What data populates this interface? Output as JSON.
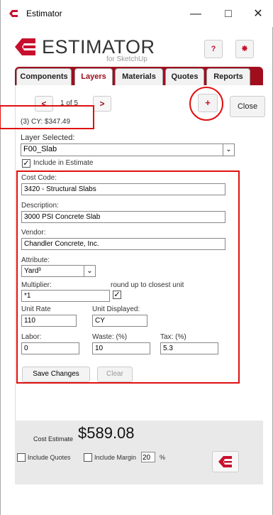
{
  "window": {
    "title": "Estimator",
    "minimize": "—",
    "maximize": "□",
    "close": "✕"
  },
  "header": {
    "logo_text": "ESTIMATOR",
    "logo_sub": "for SketchUp",
    "help_label": "?",
    "settings_icon": "gear-icon"
  },
  "tabs": [
    {
      "label": "Components"
    },
    {
      "label": "Layers"
    },
    {
      "label": "Materials"
    },
    {
      "label": "Quotes"
    },
    {
      "label": "Reports"
    }
  ],
  "nav": {
    "prev": "<",
    "next": ">",
    "page": "1 of 5",
    "add": "+",
    "close": "Close"
  },
  "summary": "(3) CY: $347.49",
  "layer": {
    "label": "Layer Selected:",
    "value": "F00_Slab",
    "include_label": "Include in Estimate"
  },
  "form": {
    "cost_code_label": "Cost Code:",
    "cost_code": "3420 - Structural Slabs",
    "description_label": "Description:",
    "description": "3000 PSI Concrete Slab",
    "vendor_label": "Vendor:",
    "vendor": "Chandler Concrete, Inc.",
    "attribute_label": "Attribute:",
    "attribute": "Yard³",
    "multiplier_label": "Multiplier:",
    "multiplier": "*1",
    "roundup_label": "round up to closest unit",
    "unit_rate_label": "Unit Rate",
    "unit_rate": "110",
    "unit_displayed_label": "Unit Displayed:",
    "unit_displayed": "CY",
    "labor_label": "Labor:",
    "labor": "0",
    "waste_label": "Waste: (%)",
    "waste": "10",
    "tax_label": "Tax: (%)",
    "tax": "5.3",
    "save_label": "Save Changes",
    "clear_label": "Clear"
  },
  "footer": {
    "cost_label": "Cost Estimate",
    "cost_value": "$589.08",
    "include_quotes": "Include Quotes",
    "include_margin": "Include Margin",
    "margin_value": "20",
    "percent": "%"
  },
  "colors": {
    "brand": "#a00e1e",
    "accent_red": "#c8102e",
    "annotation": "#e01010"
  }
}
